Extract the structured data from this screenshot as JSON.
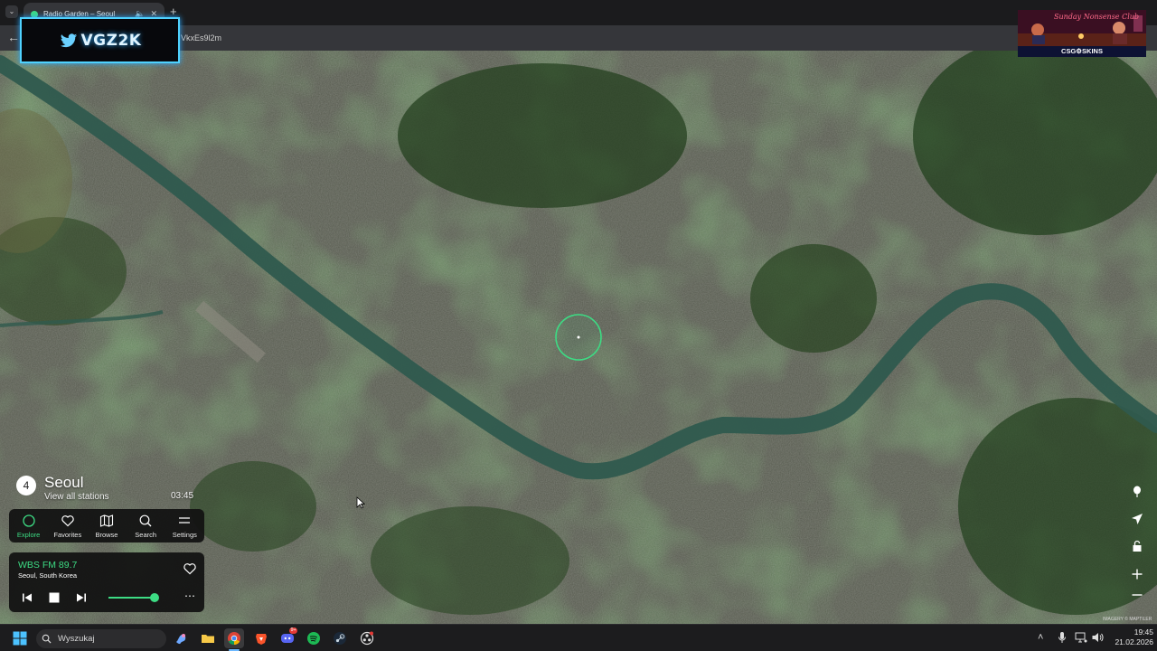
{
  "browser": {
    "tab_title": "Radio Garden – Seoul",
    "url_fragment": "VkxEs9l2m"
  },
  "overlays": {
    "streamer_handle": "VGZ2K",
    "promo_script": "Sunday Nonsense Club",
    "promo_brand": "CSG⚙SKINS"
  },
  "place": {
    "station_count": "4",
    "city": "Seoul",
    "view_all": "View all stations",
    "local_time": "03:45"
  },
  "nav": {
    "items": [
      {
        "label": "Explore",
        "icon": "explore-icon",
        "active": true
      },
      {
        "label": "Favorites",
        "icon": "heart-icon",
        "active": false
      },
      {
        "label": "Browse",
        "icon": "map-icon",
        "active": false
      },
      {
        "label": "Search",
        "icon": "search-icon",
        "active": false
      },
      {
        "label": "Settings",
        "icon": "menu-icon",
        "active": false
      }
    ]
  },
  "player": {
    "station": "WBS FM 89.7",
    "location": "Seoul, South Korea",
    "volume": 0.88,
    "more": "⋯"
  },
  "map": {
    "attribution": "IMAGERY © MAPTILER",
    "river_color": "#2f5a4e",
    "selection_color": "#3ddc84"
  },
  "taskbar": {
    "search_placeholder": "Wyszukaj",
    "time": "19:45",
    "date": "21.02.2026",
    "discord_badge": "9+"
  },
  "colors": {
    "accent": "#3ddc84",
    "panel": "#121212"
  }
}
